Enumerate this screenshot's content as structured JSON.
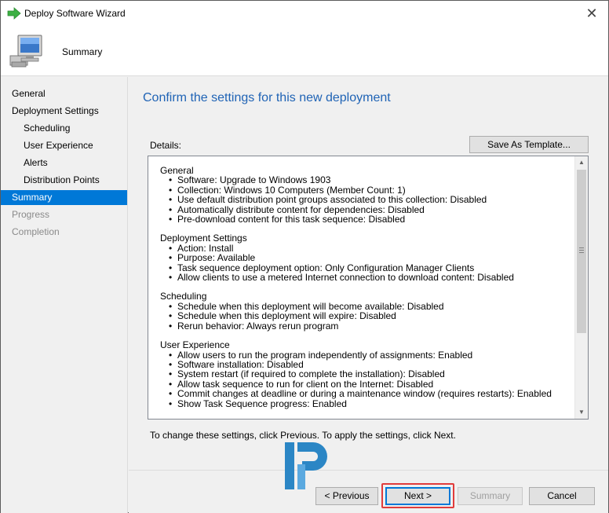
{
  "window": {
    "title": "Deploy Software Wizard",
    "close_glyph": "✕"
  },
  "header": {
    "title": "Summary"
  },
  "sidebar": {
    "items": [
      {
        "label": "General",
        "state": "normal"
      },
      {
        "label": "Deployment Settings",
        "state": "normal"
      },
      {
        "label": "Scheduling",
        "state": "normal"
      },
      {
        "label": "User Experience",
        "state": "normal"
      },
      {
        "label": "Alerts",
        "state": "normal"
      },
      {
        "label": "Distribution Points",
        "state": "normal"
      },
      {
        "label": "Summary",
        "state": "active"
      },
      {
        "label": "Progress",
        "state": "disabled"
      },
      {
        "label": "Completion",
        "state": "disabled"
      }
    ]
  },
  "main": {
    "heading": "Confirm the settings for this new deployment",
    "details_label": "Details:",
    "save_template_label": "Save As Template...",
    "footer_note": "To change these settings, click Previous. To apply the settings, click Next."
  },
  "details": {
    "sections": [
      {
        "title": "General",
        "items": [
          "Software: Upgrade to Windows 1903",
          "Collection: Windows 10 Computers (Member Count: 1)",
          "Use default distribution point groups associated to this collection: Disabled",
          "Automatically distribute content for dependencies: Disabled",
          "Pre-download content for this task sequence: Disabled"
        ]
      },
      {
        "title": "Deployment Settings",
        "items": [
          "Action: Install",
          "Purpose: Available",
          "Task sequence deployment option: Only Configuration Manager Clients",
          "Allow clients to use a metered Internet connection to download content: Disabled"
        ]
      },
      {
        "title": "Scheduling",
        "items": [
          "Schedule when this deployment will become available: Disabled",
          "Schedule when this deployment will expire: Disabled",
          "Rerun behavior: Always rerun program"
        ]
      },
      {
        "title": "User Experience",
        "items": [
          "Allow users to run the program independently of assignments: Enabled",
          "Software installation: Disabled",
          "System restart (if required to complete the installation): Disabled",
          "Allow task sequence to run for client on the Internet: Disabled",
          "Commit changes at deadline or during a maintenance window (requires restarts): Enabled",
          "Show Task Sequence progress: Enabled"
        ]
      }
    ]
  },
  "buttons": {
    "previous": "< Previous",
    "next": "Next >",
    "summary": "Summary",
    "cancel": "Cancel"
  },
  "colors": {
    "accent": "#0078d7",
    "heading": "#1f63b5",
    "highlight": "#e03c3c"
  }
}
